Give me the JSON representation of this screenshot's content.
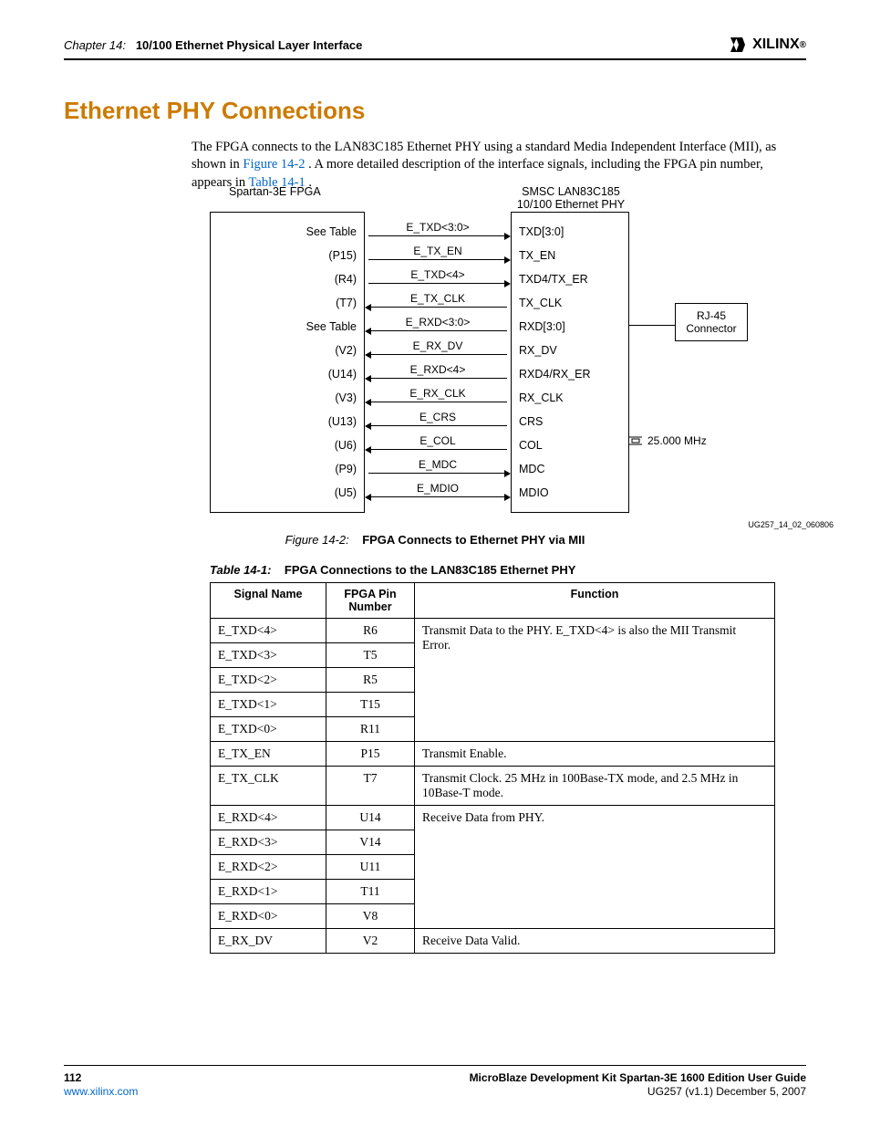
{
  "header": {
    "chapter_label": "Chapter 14:",
    "chapter_title": "10/100 Ethernet Physical Layer Interface",
    "logo_text": "XILINX",
    "logo_reg": "®"
  },
  "section": {
    "title": "Ethernet PHY Connections",
    "intro_1": "The FPGA connects to the LAN83C185 Ethernet PHY using a standard Media Independent Interface (MII), as shown in ",
    "xref_fig": "Figure 14-2",
    "intro_2": ". A more detailed description of the interface signals, including the FPGA pin number, appears in ",
    "xref_tbl": "Table 14-1",
    "intro_3": "."
  },
  "diagram": {
    "fpga_title": "Spartan-3E FPGA",
    "phy_title_l1": "SMSC LAN83C185",
    "phy_title_l2": "10/100 Ethernet PHY",
    "rj45_l1": "RJ-45",
    "rj45_l2": "Connector",
    "crystal": "25.000 MHz",
    "ug_id": "UG257_14_02_060806",
    "rows": [
      {
        "fpga": "See Table",
        "label": "E_TXD<3:0>",
        "phy": "TXD[3:0]",
        "dir": "right"
      },
      {
        "fpga": "(P15)",
        "label": "E_TX_EN",
        "phy": "TX_EN",
        "dir": "right"
      },
      {
        "fpga": "(R4)",
        "label": "E_TXD<4>",
        "phy": "TXD4/TX_ER",
        "dir": "right"
      },
      {
        "fpga": "(T7)",
        "label": "E_TX_CLK",
        "phy": "TX_CLK",
        "dir": "left"
      },
      {
        "fpga": "See Table",
        "label": "E_RXD<3:0>",
        "phy": "RXD[3:0]",
        "dir": "left"
      },
      {
        "fpga": "(V2)",
        "label": "E_RX_DV",
        "phy": "RX_DV",
        "dir": "left"
      },
      {
        "fpga": "(U14)",
        "label": "E_RXD<4>",
        "phy": "RXD4/RX_ER",
        "dir": "left"
      },
      {
        "fpga": "(V3)",
        "label": "E_RX_CLK",
        "phy": "RX_CLK",
        "dir": "left"
      },
      {
        "fpga": "(U13)",
        "label": "E_CRS",
        "phy": "CRS",
        "dir": "left"
      },
      {
        "fpga": "(U6)",
        "label": "E_COL",
        "phy": "COL",
        "dir": "left"
      },
      {
        "fpga": "(P9)",
        "label": "E_MDC",
        "phy": "MDC",
        "dir": "right"
      },
      {
        "fpga": "(U5)",
        "label": "E_MDIO",
        "phy": "MDIO",
        "dir": "both"
      }
    ]
  },
  "figure_caption": {
    "label": "Figure 14-2:",
    "title": "FPGA Connects to Ethernet PHY via MII"
  },
  "table_caption": {
    "label": "Table 14-1:",
    "title": "FPGA Connections to the LAN83C185 Ethernet PHY"
  },
  "table": {
    "headers": {
      "signal": "Signal Name",
      "pin": "FPGA Pin Number",
      "func": "Function"
    },
    "groups": [
      {
        "func": "Transmit Data to the PHY. E_TXD<4> is also the MII Transmit Error.",
        "rows": [
          {
            "sig": "E_TXD<4>",
            "pin": "R6"
          },
          {
            "sig": "E_TXD<3>",
            "pin": "T5"
          },
          {
            "sig": "E_TXD<2>",
            "pin": "R5"
          },
          {
            "sig": "E_TXD<1>",
            "pin": "T15"
          },
          {
            "sig": "E_TXD<0>",
            "pin": "R11"
          }
        ]
      },
      {
        "func": "Transmit Enable.",
        "rows": [
          {
            "sig": "E_TX_EN",
            "pin": "P15"
          }
        ]
      },
      {
        "func": "Transmit Clock. 25 MHz in 100Base-TX mode, and 2.5 MHz in 10Base-T mode.",
        "rows": [
          {
            "sig": "E_TX_CLK",
            "pin": "T7"
          }
        ]
      },
      {
        "func": "Receive Data from PHY.",
        "rows": [
          {
            "sig": "E_RXD<4>",
            "pin": "U14"
          },
          {
            "sig": "E_RXD<3>",
            "pin": "V14"
          },
          {
            "sig": "E_RXD<2>",
            "pin": "U11"
          },
          {
            "sig": "E_RXD<1>",
            "pin": "T11"
          },
          {
            "sig": "E_RXD<0>",
            "pin": "V8"
          }
        ]
      },
      {
        "func": "Receive Data Valid.",
        "rows": [
          {
            "sig": "E_RX_DV",
            "pin": "V2"
          }
        ]
      }
    ]
  },
  "footer": {
    "page_num": "112",
    "url": "www.xilinx.com",
    "doc_title": "MicroBlaze Development Kit Spartan-3E 1600 Edition User Guide",
    "doc_id": "UG257  (v1.1) December 5, 2007"
  }
}
